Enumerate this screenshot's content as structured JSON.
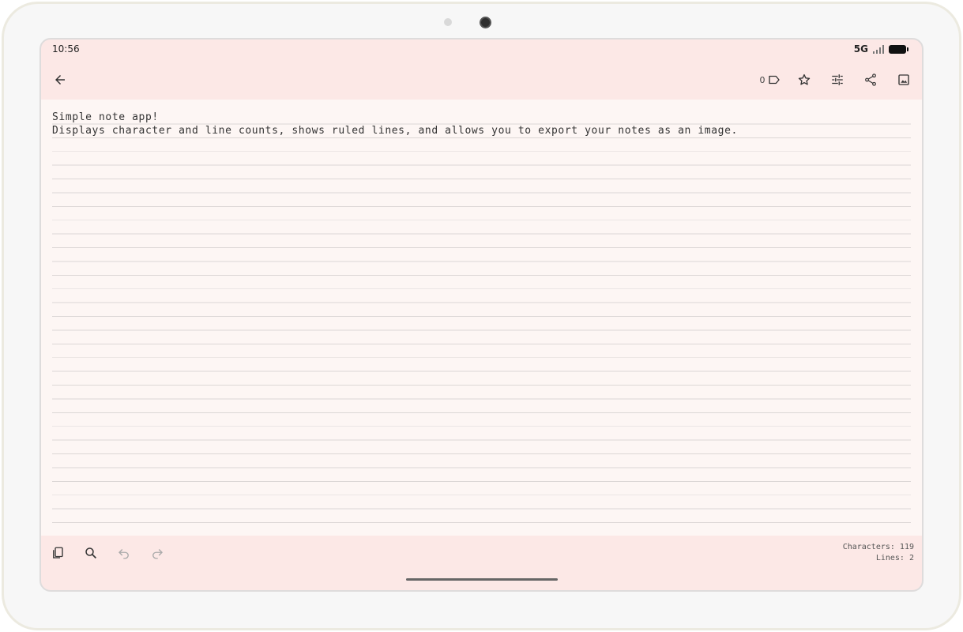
{
  "status": {
    "time": "10:56",
    "network": "5G"
  },
  "toolbar": {
    "back_icon": "arrow-left-icon",
    "tag_count": "0",
    "tag_icon": "label-icon",
    "favorite_icon": "star-outline-icon",
    "settings_icon": "tune-icon",
    "share_icon": "share-icon",
    "export_image_icon": "image-icon"
  },
  "note": {
    "text": "Simple note app!\nDisplays character and line counts, shows ruled lines, and allows you to export your notes as an image."
  },
  "bottom": {
    "copy_icon": "copy-icon",
    "search_icon": "search-icon",
    "undo_icon": "undo-icon",
    "redo_icon": "redo-icon",
    "characters_label": "Characters: 119",
    "lines_label": "Lines: 2"
  },
  "colors": {
    "app_background": "#fce8e6",
    "paper": "#fdf6f4",
    "ruled_line": "#dcd7d6"
  }
}
